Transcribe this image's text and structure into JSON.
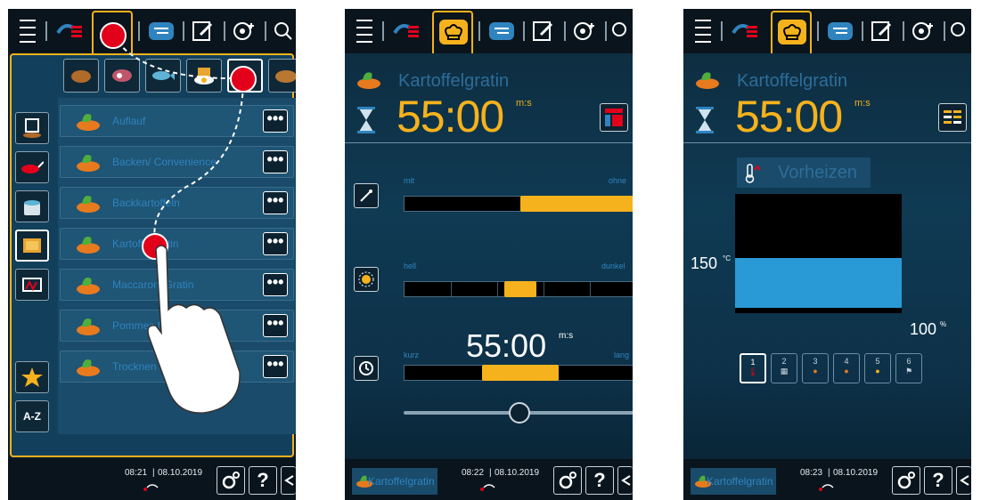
{
  "panel1": {
    "recipes": [
      {
        "label": "Auflauf"
      },
      {
        "label": "Backen/ Convenience"
      },
      {
        "label": "Backkartoffeln"
      },
      {
        "label": "Kartoffelgratin"
      },
      {
        "label": "Maccaroni Gratin"
      },
      {
        "label": "Pommes frites"
      },
      {
        "label": "Trocknen"
      }
    ],
    "more_label": "•••",
    "sort_label": "A-Z",
    "time": "08:21",
    "date": "08.10.2019",
    "help_label": "?"
  },
  "panel2": {
    "title": "Kartoffelgratin",
    "time_value": "55:00",
    "time_unit": "m:s",
    "slider1": {
      "left_label": "mit",
      "right_label": "ohne",
      "fill_start": 0.5,
      "fill_end": 1.0
    },
    "slider2": {
      "left_label": "hell",
      "right_label": "dunkel",
      "value": 0.5
    },
    "slider3": {
      "left_label": "kurz",
      "right_label": "lang",
      "time": "55:00",
      "unit": "m:s",
      "value": 0.5
    },
    "bottom_slider_value": 0.5,
    "footer_label": "Kartoffelgratin",
    "time": "08:22",
    "date": "08.10.2019",
    "help_label": "?"
  },
  "panel3": {
    "title": "Kartoffelgratin",
    "time_value": "55:00",
    "time_unit": "m:s",
    "preheat_label": "Vorheizen",
    "temperature": "150",
    "temperature_unit": "°C",
    "humidity": "100",
    "humidity_unit": "%",
    "phases": [
      "1",
      "2",
      "3",
      "4",
      "5",
      "6"
    ],
    "active_phase": 0,
    "footer_label": "Kartoffelgratin",
    "time": "08:23",
    "date": "08.10.2019",
    "help_label": "?"
  },
  "colors": {
    "accent": "#f5b21d",
    "highlight": "#e3001b",
    "blue": "#2f84bf"
  }
}
